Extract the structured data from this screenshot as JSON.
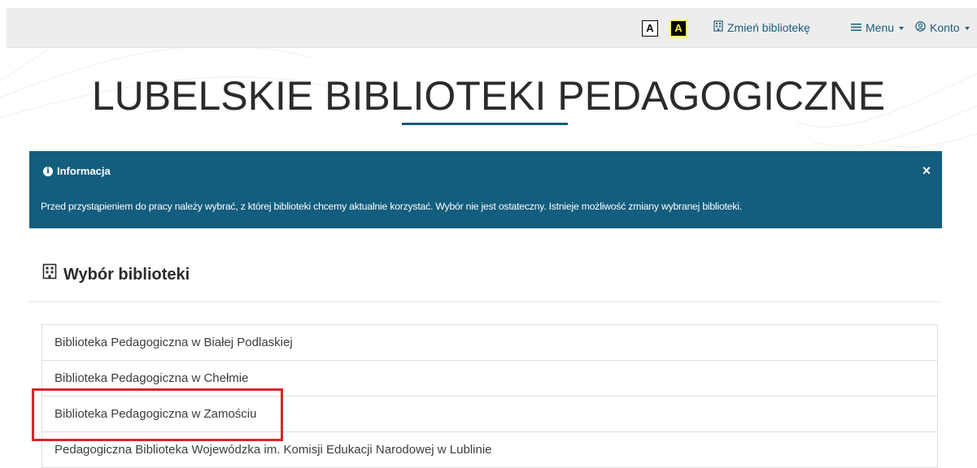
{
  "accessibility": {
    "contrast_normal_label": "A",
    "contrast_high_label": "A"
  },
  "nav": {
    "change_library_label": "Zmień bibliotekę",
    "change_library_icon": "building-icon",
    "menu_label": "Menu",
    "menu_icon": "hamburger-icon",
    "account_label": "Konto",
    "account_icon": "user-circle-icon"
  },
  "header": {
    "title": "LUBELSKIE BIBLIOTEKI PEDAGOGICZNE"
  },
  "alert": {
    "heading": "Informacja",
    "icon": "info-circle-icon",
    "close_label": "×",
    "message": "Przed przystąpieniem do pracy należy wybrać, z której biblioteki chcemy aktualnie korzystać. Wybór nie jest ostateczny. Istnieje możliwość zmiany wybranej biblioteki."
  },
  "section": {
    "title": "Wybór biblioteki",
    "icon": "building-icon"
  },
  "libraries": [
    {
      "label": "Biblioteka Pedagogiczna w Białej Podlaskiej"
    },
    {
      "label": "Biblioteka Pedagogiczna w Chełmie"
    },
    {
      "label": "Biblioteka Pedagogiczna w Zamościu"
    },
    {
      "label": "Pedagogiczna Biblioteka Wojewódzka im. Komisji Edukacji Narodowej w Lublinie"
    }
  ],
  "colors": {
    "accent": "#135d7e",
    "link": "#1b5f7e",
    "highlight": "#d7262b",
    "high_contrast_text": "#ffff00"
  }
}
